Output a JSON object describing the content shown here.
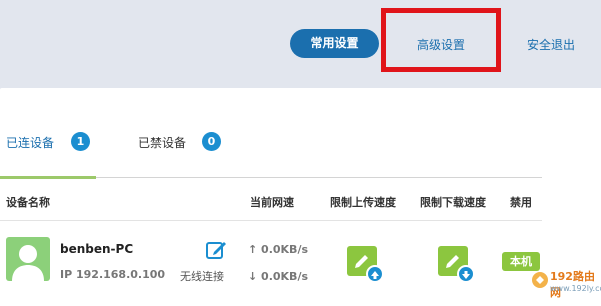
{
  "nav": {
    "common_settings": "常用设置",
    "advanced_settings": "高级设置",
    "logout": "安全退出"
  },
  "tabs": [
    {
      "label": "已连设备",
      "count": "1",
      "active": true
    },
    {
      "label": "已禁设备",
      "count": "0",
      "active": false
    }
  ],
  "table": {
    "headers": [
      "设备名称",
      "当前网速",
      "限制上传速度",
      "限制下载速度",
      "禁用"
    ],
    "rows": [
      {
        "name": "benben-PC",
        "ip": "IP 192.168.0.100",
        "connection": "无线连接",
        "upload_speed": "↑ 0.0KB/s",
        "download_speed": "↓ 0.0KB/s",
        "tag": "本机"
      }
    ]
  },
  "watermark": {
    "title": "192路由网",
    "url": "www.192ly.com"
  },
  "colors": {
    "accent_blue": "#1b6fae",
    "badge_blue": "#1b8ed0",
    "green": "#8cc63f",
    "highlight_red": "#e0141a"
  },
  "icons": [
    "edit-icon",
    "upload-limit-icon",
    "download-limit-icon",
    "avatar-user-icon",
    "arrow-up-icon",
    "arrow-down-icon"
  ]
}
